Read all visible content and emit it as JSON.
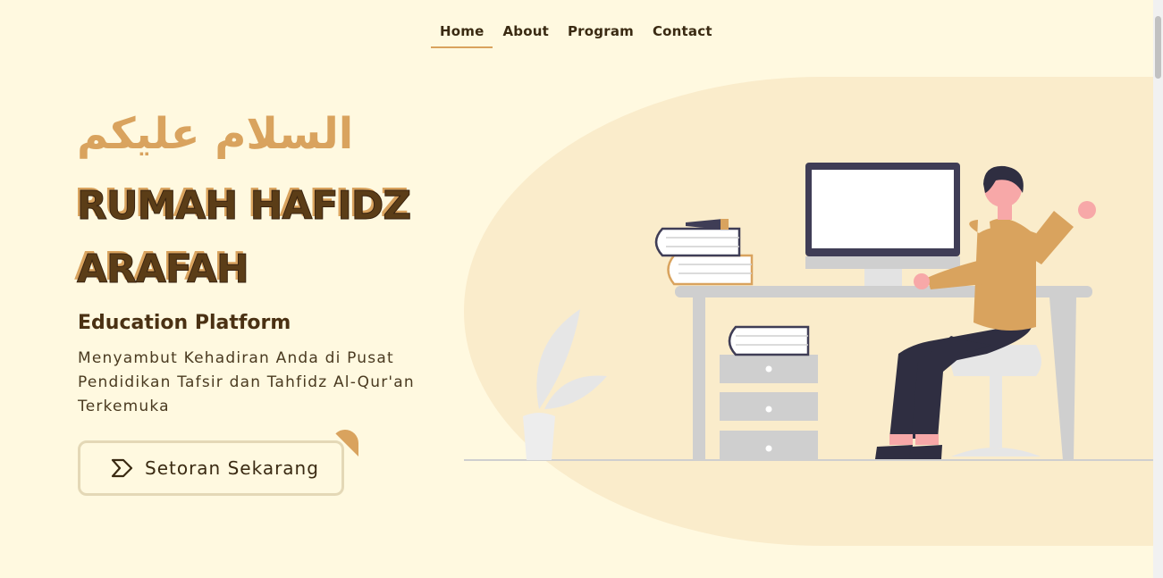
{
  "nav": {
    "items": [
      {
        "label": "Home",
        "active": true
      },
      {
        "label": "About",
        "active": false
      },
      {
        "label": "Program",
        "active": false
      },
      {
        "label": "Contact",
        "active": false
      }
    ]
  },
  "hero": {
    "greeting": "السلام عليكم",
    "title_line1": "RUMAH HAFIDZ",
    "title_line2": "ARAFAH",
    "subtitle": "Education Platform",
    "description": "Menyambut Kehadiran Anda di Pusat Pendidikan Tafsir dan Tahfidz Al-Qur'an Terkemuka",
    "cta_label": "Setoran Sekarang",
    "cta_icon": "chevron-right-icon"
  },
  "colors": {
    "background": "#fff9e0",
    "accent": "#d9a35e",
    "title": "#5b3d17",
    "blob": "#faeccb"
  }
}
